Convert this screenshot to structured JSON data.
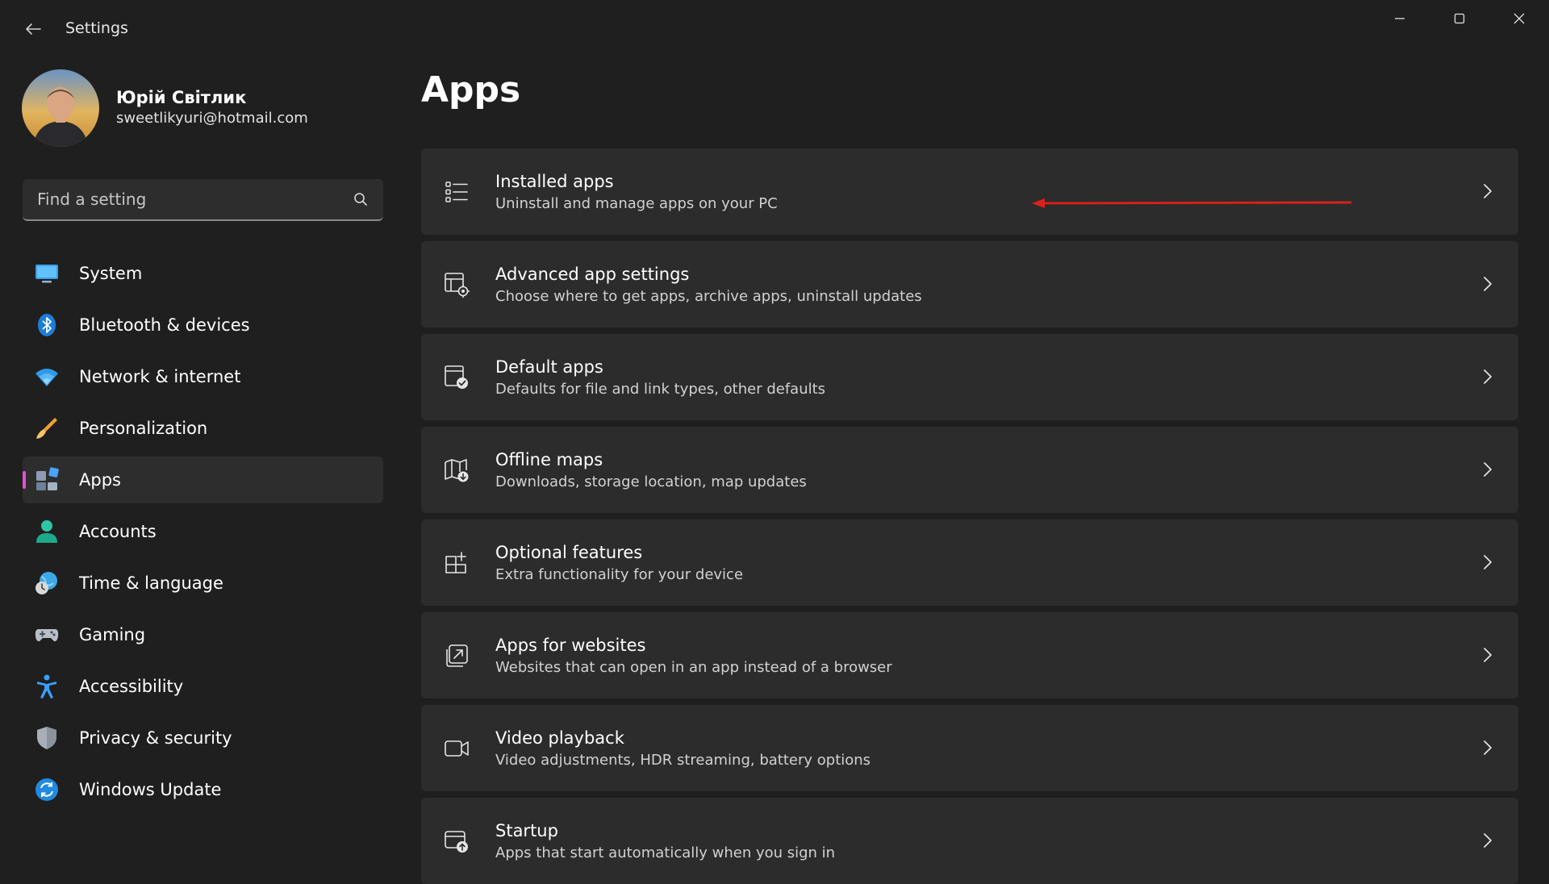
{
  "window": {
    "title": "Settings",
    "controls": [
      "minimize-icon",
      "maximize-icon",
      "close-icon"
    ]
  },
  "profile": {
    "name": "Юрій Світлик",
    "email": "sweetlikyuri@hotmail.com"
  },
  "search": {
    "placeholder": "Find a setting",
    "value": ""
  },
  "sidebar": {
    "items": [
      {
        "label": "System",
        "icon": "system-icon"
      },
      {
        "label": "Bluetooth & devices",
        "icon": "bluetooth-icon"
      },
      {
        "label": "Network & internet",
        "icon": "wifi-icon"
      },
      {
        "label": "Personalization",
        "icon": "brush-icon"
      },
      {
        "label": "Apps",
        "icon": "apps-icon",
        "selected": true
      },
      {
        "label": "Accounts",
        "icon": "person-icon"
      },
      {
        "label": "Time & language",
        "icon": "globe-clock-icon"
      },
      {
        "label": "Gaming",
        "icon": "gamepad-icon"
      },
      {
        "label": "Accessibility",
        "icon": "accessibility-icon"
      },
      {
        "label": "Privacy & security",
        "icon": "shield-icon"
      },
      {
        "label": "Windows Update",
        "icon": "update-icon"
      }
    ],
    "accent_color": "#e84fd1"
  },
  "main": {
    "title": "Apps",
    "cards": [
      {
        "title": "Installed apps",
        "description": "Uninstall and manage apps on your PC",
        "icon": "list-icon"
      },
      {
        "title": "Advanced app settings",
        "description": "Choose where to get apps, archive apps, uninstall updates",
        "icon": "app-settings-icon"
      },
      {
        "title": "Default apps",
        "description": "Defaults for file and link types, other defaults",
        "icon": "default-apps-icon"
      },
      {
        "title": "Offline maps",
        "description": "Downloads, storage location, map updates",
        "icon": "map-download-icon"
      },
      {
        "title": "Optional features",
        "description": "Extra functionality for your device",
        "icon": "add-grid-icon"
      },
      {
        "title": "Apps for websites",
        "description": "Websites that can open in an app instead of a browser",
        "icon": "open-link-icon"
      },
      {
        "title": "Video playback",
        "description": "Video adjustments, HDR streaming, battery options",
        "icon": "video-icon"
      },
      {
        "title": "Startup",
        "description": "Apps that start automatically when you sign in",
        "icon": "startup-icon"
      }
    ]
  },
  "annotation": {
    "color": "#e0201b"
  }
}
